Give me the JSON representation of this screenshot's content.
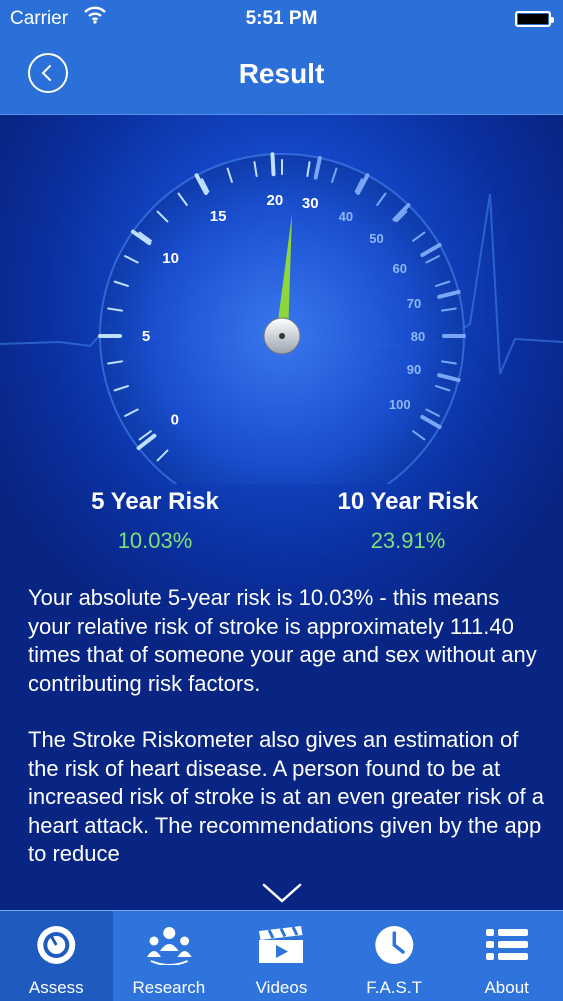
{
  "status_bar": {
    "carrier": "Carrier",
    "time": "5:51 PM"
  },
  "nav": {
    "title": "Result"
  },
  "gauge": {
    "tick_labels_left": [
      "0",
      "5",
      "10",
      "15",
      "20"
    ],
    "tick_labels_right": [
      "30",
      "40",
      "50",
      "60",
      "70",
      "80",
      "90",
      "100"
    ],
    "needle_value": 20
  },
  "risk": {
    "five_year_label": "5 Year Risk",
    "five_year_value": "10.03%",
    "ten_year_label": "10 Year Risk",
    "ten_year_value": "23.91%"
  },
  "description": {
    "paragraph1": "Your absolute 5-year risk is 10.03% - this means your relative risk of stroke is approximately 111.40 times that of someone your age and sex without any contributing risk factors.",
    "paragraph2": "The Stroke Riskometer also gives an estimation of the risk of heart disease. A person found to be at increased risk of stroke is at an even greater risk of a heart attack. The recommendations given by the app to reduce"
  },
  "tabs": [
    {
      "label": "Assess",
      "icon": "gauge-icon",
      "active": true
    },
    {
      "label": "Research",
      "icon": "people-icon",
      "active": false
    },
    {
      "label": "Videos",
      "icon": "clapperboard-icon",
      "active": false
    },
    {
      "label": "F.A.S.T",
      "icon": "clock-icon",
      "active": false
    },
    {
      "label": "About",
      "icon": "list-icon",
      "active": false
    }
  ],
  "colors": {
    "accent": "#2b6fd8",
    "risk_value": "#7fe07a",
    "needle": "#8fd63a"
  }
}
